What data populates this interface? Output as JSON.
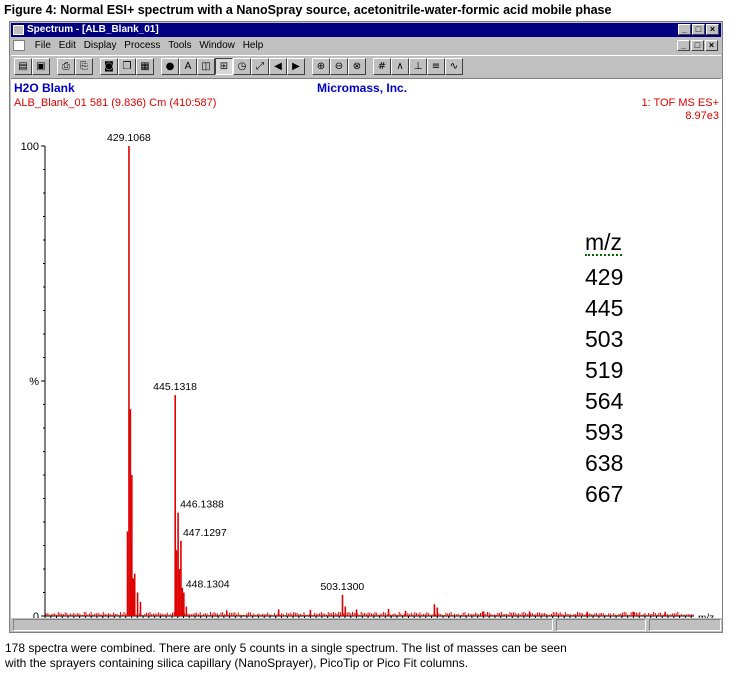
{
  "figure_title": "Figure 4:  Normal ESI+ spectrum with a NanoSpray source, acetonitrile-water-formic acid mobile phase",
  "window": {
    "title": "Spectrum - [ALB_Blank_01]",
    "buttons": [
      "_",
      "□",
      "×"
    ]
  },
  "menu": {
    "items": [
      "File",
      "Edit",
      "Display",
      "Process",
      "Tools",
      "Window",
      "Help"
    ]
  },
  "toolbar": {
    "icons": [
      "open-icon",
      "save-icon",
      "print-icon",
      "print-preview-icon",
      "camera-icon",
      "copy-icon",
      "paste-icon",
      "color-icon",
      "text-icon",
      "rectangle-icon",
      "link-icon",
      "clock-icon",
      "fit-icon",
      "left-arrow-icon",
      "right-arrow-icon",
      "zoom-in-icon",
      "zoom-out-icon",
      "zoom-reset-icon",
      "grid-icon",
      "spectrum-icon",
      "peak-icon",
      "list-icon",
      "smooth-icon"
    ]
  },
  "header": {
    "sample": "H2O Blank",
    "company": "Micromass, Inc.",
    "scan_info": "ALB_Blank_01 581 (9.836) Cm (410:587)",
    "function": "1: TOF MS ES+",
    "intensity": "8.97e3"
  },
  "mz_list": {
    "title": "m/z",
    "values": [
      "429",
      "445",
      "503",
      "519",
      "564",
      "593",
      "638",
      "667"
    ]
  },
  "chart_data": {
    "type": "bar",
    "xlabel": "m/z",
    "ylabel": "%",
    "xlim": [
      400,
      625
    ],
    "ylim": [
      0,
      100
    ],
    "x_ticks": [
      400,
      420,
      440,
      460,
      480,
      500,
      520,
      540,
      560,
      580,
      600
    ],
    "y_ticks": [
      "0",
      "%",
      "100"
    ],
    "color": "#e00000",
    "peaks": [
      {
        "x": 428.6,
        "y": 18
      },
      {
        "x": 429.1068,
        "y": 100,
        "label": "429.1068"
      },
      {
        "x": 429.6,
        "y": 44
      },
      {
        "x": 430.1,
        "y": 30
      },
      {
        "x": 430.6,
        "y": 8
      },
      {
        "x": 431.1,
        "y": 9
      },
      {
        "x": 432.1,
        "y": 5
      },
      {
        "x": 433.1,
        "y": 3
      },
      {
        "x": 445.1318,
        "y": 47,
        "label": "445.1318"
      },
      {
        "x": 445.6,
        "y": 14
      },
      {
        "x": 446.1388,
        "y": 22,
        "label": "446.1388"
      },
      {
        "x": 446.6,
        "y": 10
      },
      {
        "x": 447.1297,
        "y": 16,
        "label": "447.1297"
      },
      {
        "x": 447.6,
        "y": 6
      },
      {
        "x": 448.1304,
        "y": 5,
        "label": "448.1304"
      },
      {
        "x": 449.0,
        "y": 2
      },
      {
        "x": 503.13,
        "y": 4.5,
        "label": "503.1300"
      },
      {
        "x": 504.1,
        "y": 2
      },
      {
        "x": 519.1,
        "y": 1.5
      },
      {
        "x": 535.0,
        "y": 2.5
      },
      {
        "x": 536.0,
        "y": 1.8
      },
      {
        "x": 463.0,
        "y": 1.2
      },
      {
        "x": 481.0,
        "y": 1.4
      },
      {
        "x": 492.0,
        "y": 1.3
      },
      {
        "x": 508.0,
        "y": 1.4
      },
      {
        "x": 525.0,
        "y": 1.1
      },
      {
        "x": 552.0,
        "y": 1.0
      },
      {
        "x": 568.0,
        "y": 1.0
      },
      {
        "x": 588.0,
        "y": 0.9
      },
      {
        "x": 604.0,
        "y": 0.9
      },
      {
        "x": 615.0,
        "y": 0.9
      }
    ]
  },
  "caption": {
    "line1": "178 spectra were combined.  There are only 5 counts in a single spectrum.  The list of masses can be seen",
    "line2": "with the sprayers containing silica capillary (NanoSprayer), PicoTip or Pico Fit columns."
  }
}
